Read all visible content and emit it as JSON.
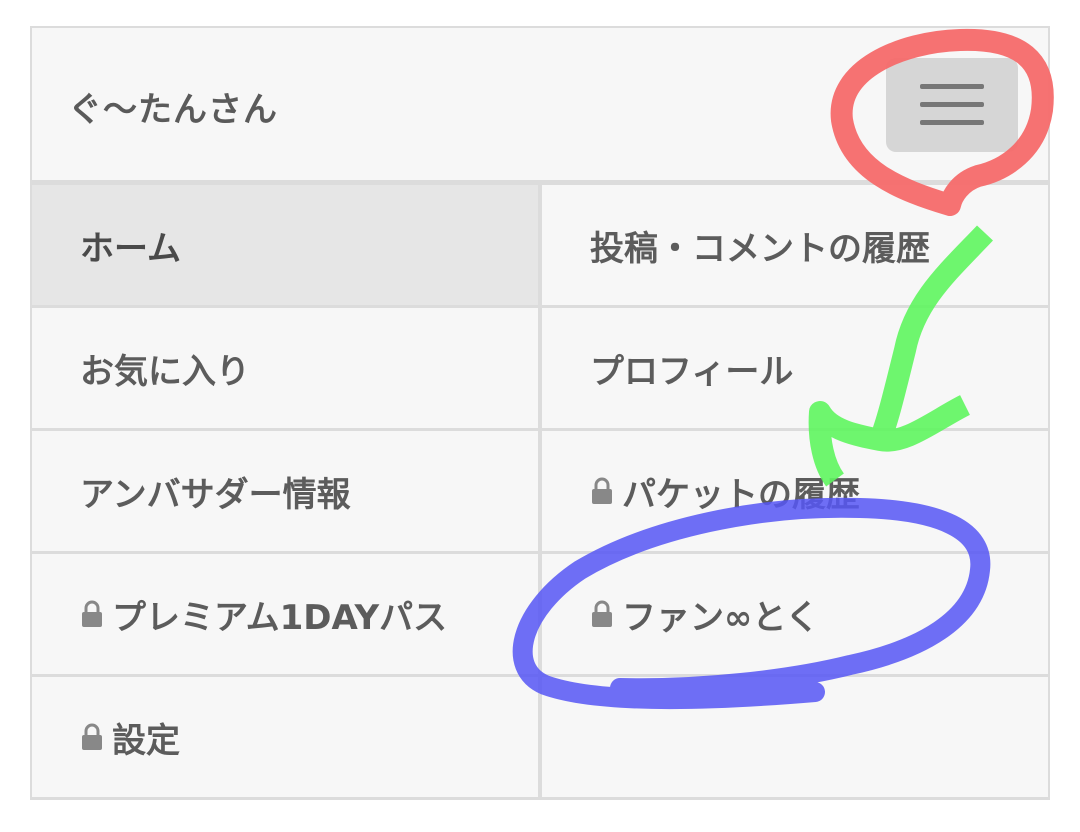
{
  "header": {
    "user_name": "ぐ〜たんさん",
    "menu_icon": "hamburger-menu-icon"
  },
  "menu": {
    "items": [
      {
        "label": "ホーム",
        "locked": false,
        "active": true
      },
      {
        "label": "投稿・コメントの履歴",
        "locked": false,
        "active": false
      },
      {
        "label": "お気に入り",
        "locked": false,
        "active": false
      },
      {
        "label": "プロフィール",
        "locked": false,
        "active": false
      },
      {
        "label": "アンバサダー情報",
        "locked": false,
        "active": false
      },
      {
        "label": "パケットの履歴",
        "locked": true,
        "active": false
      },
      {
        "label": "プレミアム1DAYパス",
        "locked": true,
        "active": false
      },
      {
        "label": "ファン∞とく",
        "locked": true,
        "active": false
      },
      {
        "label": "設定",
        "locked": true,
        "active": false
      }
    ],
    "lock_icon": "lock-icon"
  },
  "annotations": {
    "red_circle_color": "#f66a6a",
    "green_arrow_color": "#5ef55e",
    "blue_circle_color": "#5656f5"
  }
}
